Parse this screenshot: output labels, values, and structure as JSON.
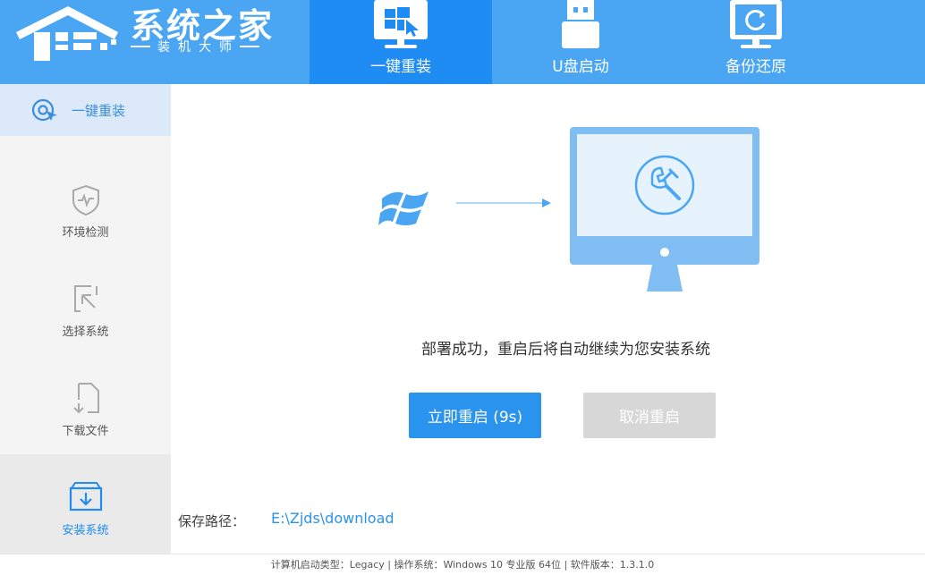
{
  "brand": {
    "title": "系统之家",
    "subtitle": "装机大师"
  },
  "nav": {
    "tabs": [
      {
        "label": "一键重装",
        "icon": "windows-install-icon",
        "active": true
      },
      {
        "label": "U盘启动",
        "icon": "usb-drive-icon",
        "active": false
      },
      {
        "label": "备份还原",
        "icon": "backup-restore-icon",
        "active": false
      }
    ]
  },
  "sidebar": {
    "header_label": "一键重装",
    "steps": [
      {
        "label": "环境检测",
        "icon": "shield-pulse-icon"
      },
      {
        "label": "选择系统",
        "icon": "cursor-select-icon"
      },
      {
        "label": "下载文件",
        "icon": "file-download-icon"
      },
      {
        "label": "安装系统",
        "icon": "install-box-icon",
        "current": true
      }
    ]
  },
  "main": {
    "status_text": "部署成功，重启后将自动继续为您安装系统",
    "restart_button": "立即重启 (9s)",
    "cancel_button": "取消重启",
    "save_path_label": "保存路径：",
    "save_path_value": "E:\\Zjds\\download"
  },
  "footer": {
    "text": "计算机启动类型：Legacy | 操作系统：Windows 10 专业版 64位 | 软件版本：1.3.1.0"
  },
  "colors": {
    "header": "#4aa6f3",
    "active_tab": "#1e8cf2",
    "sidebar": "#f4f4f4",
    "sidebar_header": "#dbe9f8",
    "primary_button": "#2a93ee",
    "disabled_button": "#d7d7d7",
    "link": "#2a93ee"
  }
}
